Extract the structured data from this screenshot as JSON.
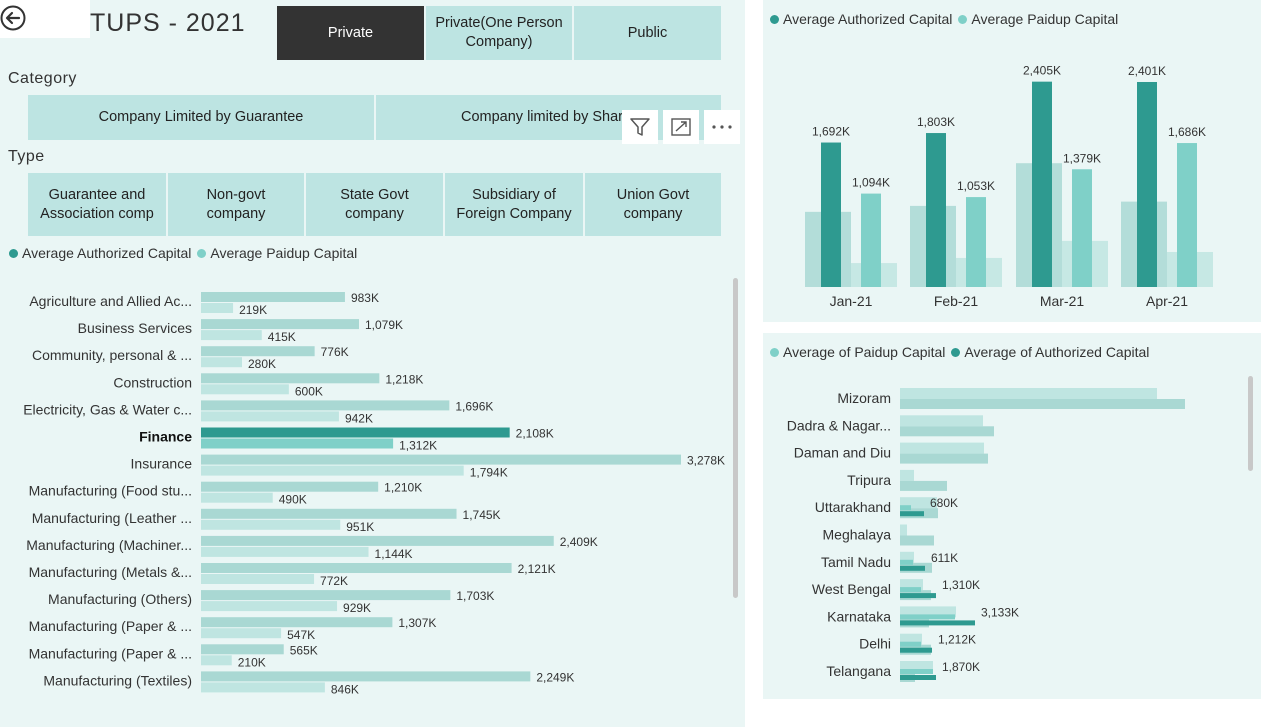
{
  "header": {
    "title": "TUPS - 2021"
  },
  "company_class": {
    "options": [
      {
        "label": "Private",
        "selected": true
      },
      {
        "label": "Private(One Person Company)",
        "selected": false
      },
      {
        "label": "Public",
        "selected": false
      }
    ]
  },
  "category": {
    "label": "Category",
    "options": [
      {
        "label": "Company Limited by Guarantee"
      },
      {
        "label": "Company limited by Shar"
      }
    ]
  },
  "type": {
    "label": "Type",
    "options": [
      {
        "label": "Guarantee and Association comp"
      },
      {
        "label": "Non-govt company"
      },
      {
        "label": "State Govt company"
      },
      {
        "label": "Subsidiary of Foreign Company"
      },
      {
        "label": "Union Govt company"
      }
    ]
  },
  "colors": {
    "authorized": "#2e9a90",
    "paidup": "#7fd0c8",
    "bar_light": "#a9d8d3",
    "bar_lighter": "#bfe5e1",
    "panel_bg": "#eaf6f5",
    "slicer_bg": "#bde4e2",
    "selected_bg": "#333333"
  },
  "chart_data": [
    {
      "id": "industry",
      "type": "bar",
      "orientation": "horizontal",
      "legend": [
        "Average Authorized Capital",
        "Average Paidup Capital"
      ],
      "highlighted": "Finance",
      "categories": [
        "Agriculture and Allied Ac...",
        "Business Services",
        "Community, personal & ...",
        "Construction",
        "Electricity, Gas & Water c...",
        "Finance",
        "Insurance",
        "Manufacturing (Food stu...",
        "Manufacturing (Leather ...",
        "Manufacturing (Machiner...",
        "Manufacturing (Metals &...",
        "Manufacturing (Others)",
        "Manufacturing (Paper & ...",
        "Manufacturing (Paper & ...",
        "Manufacturing (Textiles)"
      ],
      "series": [
        {
          "name": "Average Authorized Capital",
          "values": [
            983,
            1079,
            776,
            1218,
            1696,
            2108,
            3278,
            1210,
            1745,
            2409,
            2121,
            1703,
            1307,
            565,
            2249
          ],
          "labels": [
            "983K",
            "1,079K",
            "776K",
            "1,218K",
            "1,696K",
            "2,108K",
            "3,278K",
            "1,210K",
            "1,745K",
            "2,409K",
            "2,121K",
            "1,703K",
            "1,307K",
            "565K",
            "2,249K"
          ]
        },
        {
          "name": "Average Paidup Capital",
          "values": [
            219,
            415,
            280,
            600,
            942,
            1312,
            1794,
            490,
            951,
            1144,
            772,
            929,
            547,
            210,
            846
          ],
          "labels": [
            "219K",
            "415K",
            "280K",
            "600K",
            "942K",
            "1,312K",
            "1,794K",
            "490K",
            "951K",
            "1,144K",
            "772K",
            "929K",
            "547K",
            "210K",
            "846K"
          ]
        }
      ]
    },
    {
      "id": "monthly",
      "type": "bar",
      "legend": [
        "Average Authorized Capital",
        "Average Paidup Capital"
      ],
      "categories": [
        "Jan-21",
        "Feb-21",
        "Mar-21",
        "Apr-21"
      ],
      "series": [
        {
          "name": "Average Authorized Capital",
          "values": [
            1692,
            1803,
            2405,
            2401
          ],
          "labels": [
            "1,692K",
            "1,803K",
            "2,405K",
            "2,401K"
          ]
        },
        {
          "name": "Average Paidup Capital",
          "values": [
            1094,
            1053,
            1379,
            1686
          ],
          "labels": [
            "1,094K",
            "1,053K",
            "1,379K",
            "1,686K"
          ]
        }
      ],
      "background_values": [
        [
          880,
          880,
          280,
          280
        ],
        [
          950,
          950,
          340,
          340
        ],
        [
          1450,
          1450,
          540,
          540
        ],
        [
          1000,
          1000,
          410,
          410
        ]
      ],
      "ymax": 2600
    },
    {
      "id": "state",
      "type": "bar",
      "orientation": "horizontal",
      "legend": [
        "Average of Paidup Capital",
        "Average of Authorized Capital"
      ],
      "categories": [
        "Mizoram",
        "Dadra & Nagar...",
        "Daman and Diu",
        "Tripura",
        "Uttarakhand",
        "Meghalaya",
        "Tamil Nadu",
        "West Bengal",
        "Karnataka",
        "Delhi",
        "Telangana"
      ],
      "background_values": [
        [
          25700,
          28500
        ],
        [
          8300,
          9400
        ],
        [
          8400,
          8800
        ],
        [
          1400,
          4700
        ],
        [
          3700,
          3800
        ],
        [
          700,
          3400
        ],
        [
          1400,
          3200
        ],
        [
          2300,
          3100
        ],
        [
          5600,
          2900
        ],
        [
          2200,
          3100
        ],
        [
          3300,
          1500
        ]
      ],
      "series": [
        {
          "name": "Average of Paidup Capital",
          "values": [
            null,
            null,
            null,
            null,
            1100,
            null,
            1300,
            2100,
            5500,
            2100,
            3300
          ],
          "labels": [
            "",
            "",
            "",
            "",
            "",
            "",
            "",
            "",
            "",
            "",
            ""
          ]
        },
        {
          "name": "Average of Authorized Capital",
          "values": [
            null,
            null,
            null,
            null,
            2400,
            null,
            2500,
            3600,
            7500,
            3200,
            3600
          ],
          "labels": [
            "",
            "",
            "",
            "",
            "680K",
            "",
            "611K",
            "1,310K",
            "3,133K",
            "1,212K",
            "1,870K"
          ]
        }
      ],
      "xmax": 30000
    }
  ]
}
